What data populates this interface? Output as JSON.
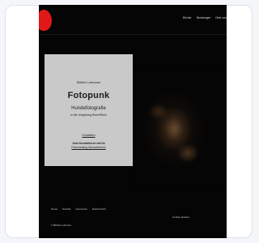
{
  "header": {
    "nav": [
      "Bücher",
      "Beratungen",
      "Über uns"
    ]
  },
  "info_box": {
    "name": "Bärbel Lohmann",
    "title": "Fotopunk",
    "subtitle": "Hundefotografie",
    "tagline": "in der Umgebung Bonn/Rhein",
    "link": "Kontakten",
    "cta_line1": "Jetzt Kontaktieren mit Ihr",
    "cta_line2": "Fotoshooting-Wunschtermin"
  },
  "footer": {
    "links": [
      "Home",
      "Kontakt",
      "Impressum",
      "Datenschutz"
    ],
    "right_text": "Cookie-Hinweis",
    "copyright": "© Bärbel Lohmann"
  },
  "colors": {
    "site_background": "#050505",
    "logo_accent": "#e01818",
    "info_box": "#c9c9c9"
  }
}
